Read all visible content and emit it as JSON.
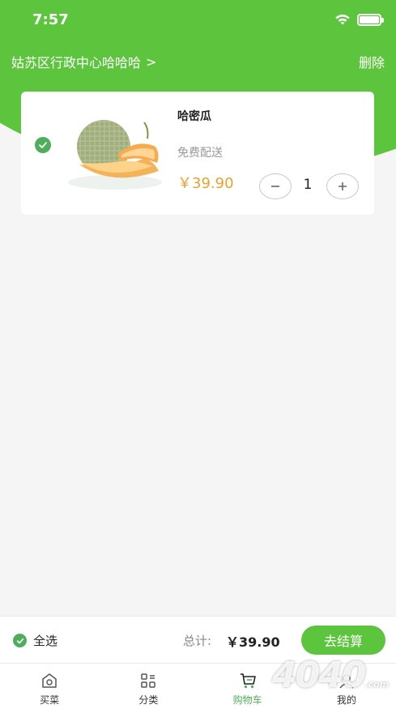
{
  "status_bar": {
    "time": "7:57"
  },
  "header": {
    "address": "姑苏区行政中心哈哈哈",
    "address_chevron": ">",
    "delete_label": "删除"
  },
  "cart_item": {
    "name": "哈密瓜",
    "delivery": "免费配送",
    "price": "￥39.90",
    "quantity": "1",
    "checked": true,
    "image_icon": "melon-image"
  },
  "checkout": {
    "select_all_label": "全选",
    "total_label": "总计:",
    "total_value": "￥39.90",
    "checkout_label": "去结算"
  },
  "tabs": [
    {
      "label": "买菜",
      "icon": "home-icon",
      "active": false
    },
    {
      "label": "分类",
      "icon": "category-icon",
      "active": false
    },
    {
      "label": "购物车",
      "icon": "cart-icon",
      "active": true
    },
    {
      "label": "我的",
      "icon": "user-icon",
      "active": false
    }
  ],
  "watermark": {
    "text": "4040",
    "suffix": ".com"
  },
  "colors": {
    "brand_green": "#5cc43d",
    "check_green": "#4fae5c",
    "price_orange": "#f0a030"
  }
}
